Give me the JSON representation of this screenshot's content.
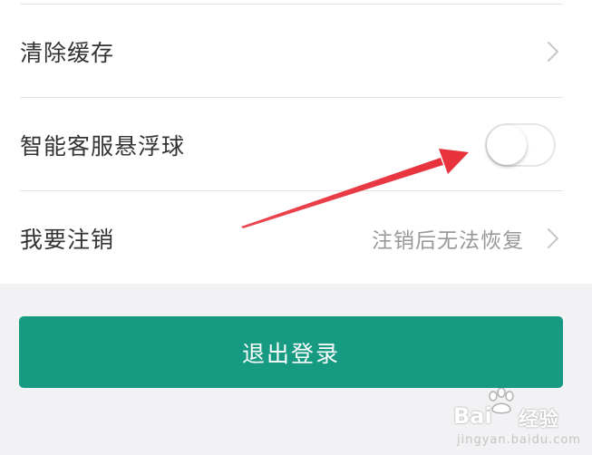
{
  "settings": {
    "items": [
      {
        "label": "清除缓存"
      },
      {
        "label": "智能客服悬浮球",
        "toggle_on": false
      },
      {
        "label": "我要注销",
        "value": "注销后无法恢复"
      }
    ]
  },
  "logout_button": {
    "label": "退出登录"
  },
  "colors": {
    "accent": "#169a81",
    "annotation_arrow": "#e8323c",
    "page_background": "#f2f2f5"
  },
  "watermark": {
    "logo_text": "Bai",
    "logo_text2": "经验",
    "url": "jingyan.baidu.com"
  }
}
